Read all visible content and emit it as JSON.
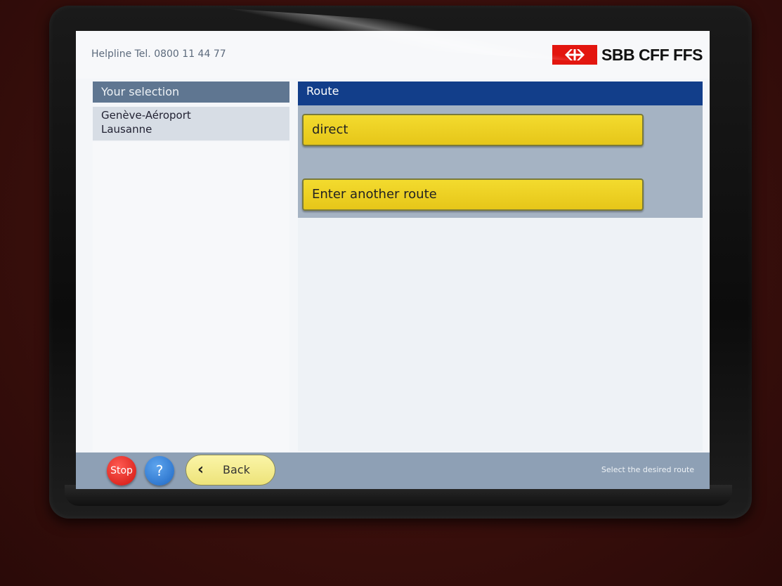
{
  "header": {
    "helpline": "Helpline Tel. 0800 11 44 77",
    "brand": "SBB CFF FFS",
    "brand_color": "#e3160f"
  },
  "selection": {
    "title": "Your selection",
    "items": [
      "Genève-Aéroport",
      "Lausanne"
    ]
  },
  "route": {
    "title": "Route",
    "options": [
      "direct",
      "Enter another route"
    ]
  },
  "footer": {
    "stop_label": "Stop",
    "help_label": "?",
    "back_label": "Back",
    "status": "Select the desired route"
  },
  "colors": {
    "panel_header_left": "#5f7691",
    "panel_header_right": "#123e8a",
    "option_yellow": "#f3db2e",
    "footer_bar": "#8ea0b5"
  }
}
